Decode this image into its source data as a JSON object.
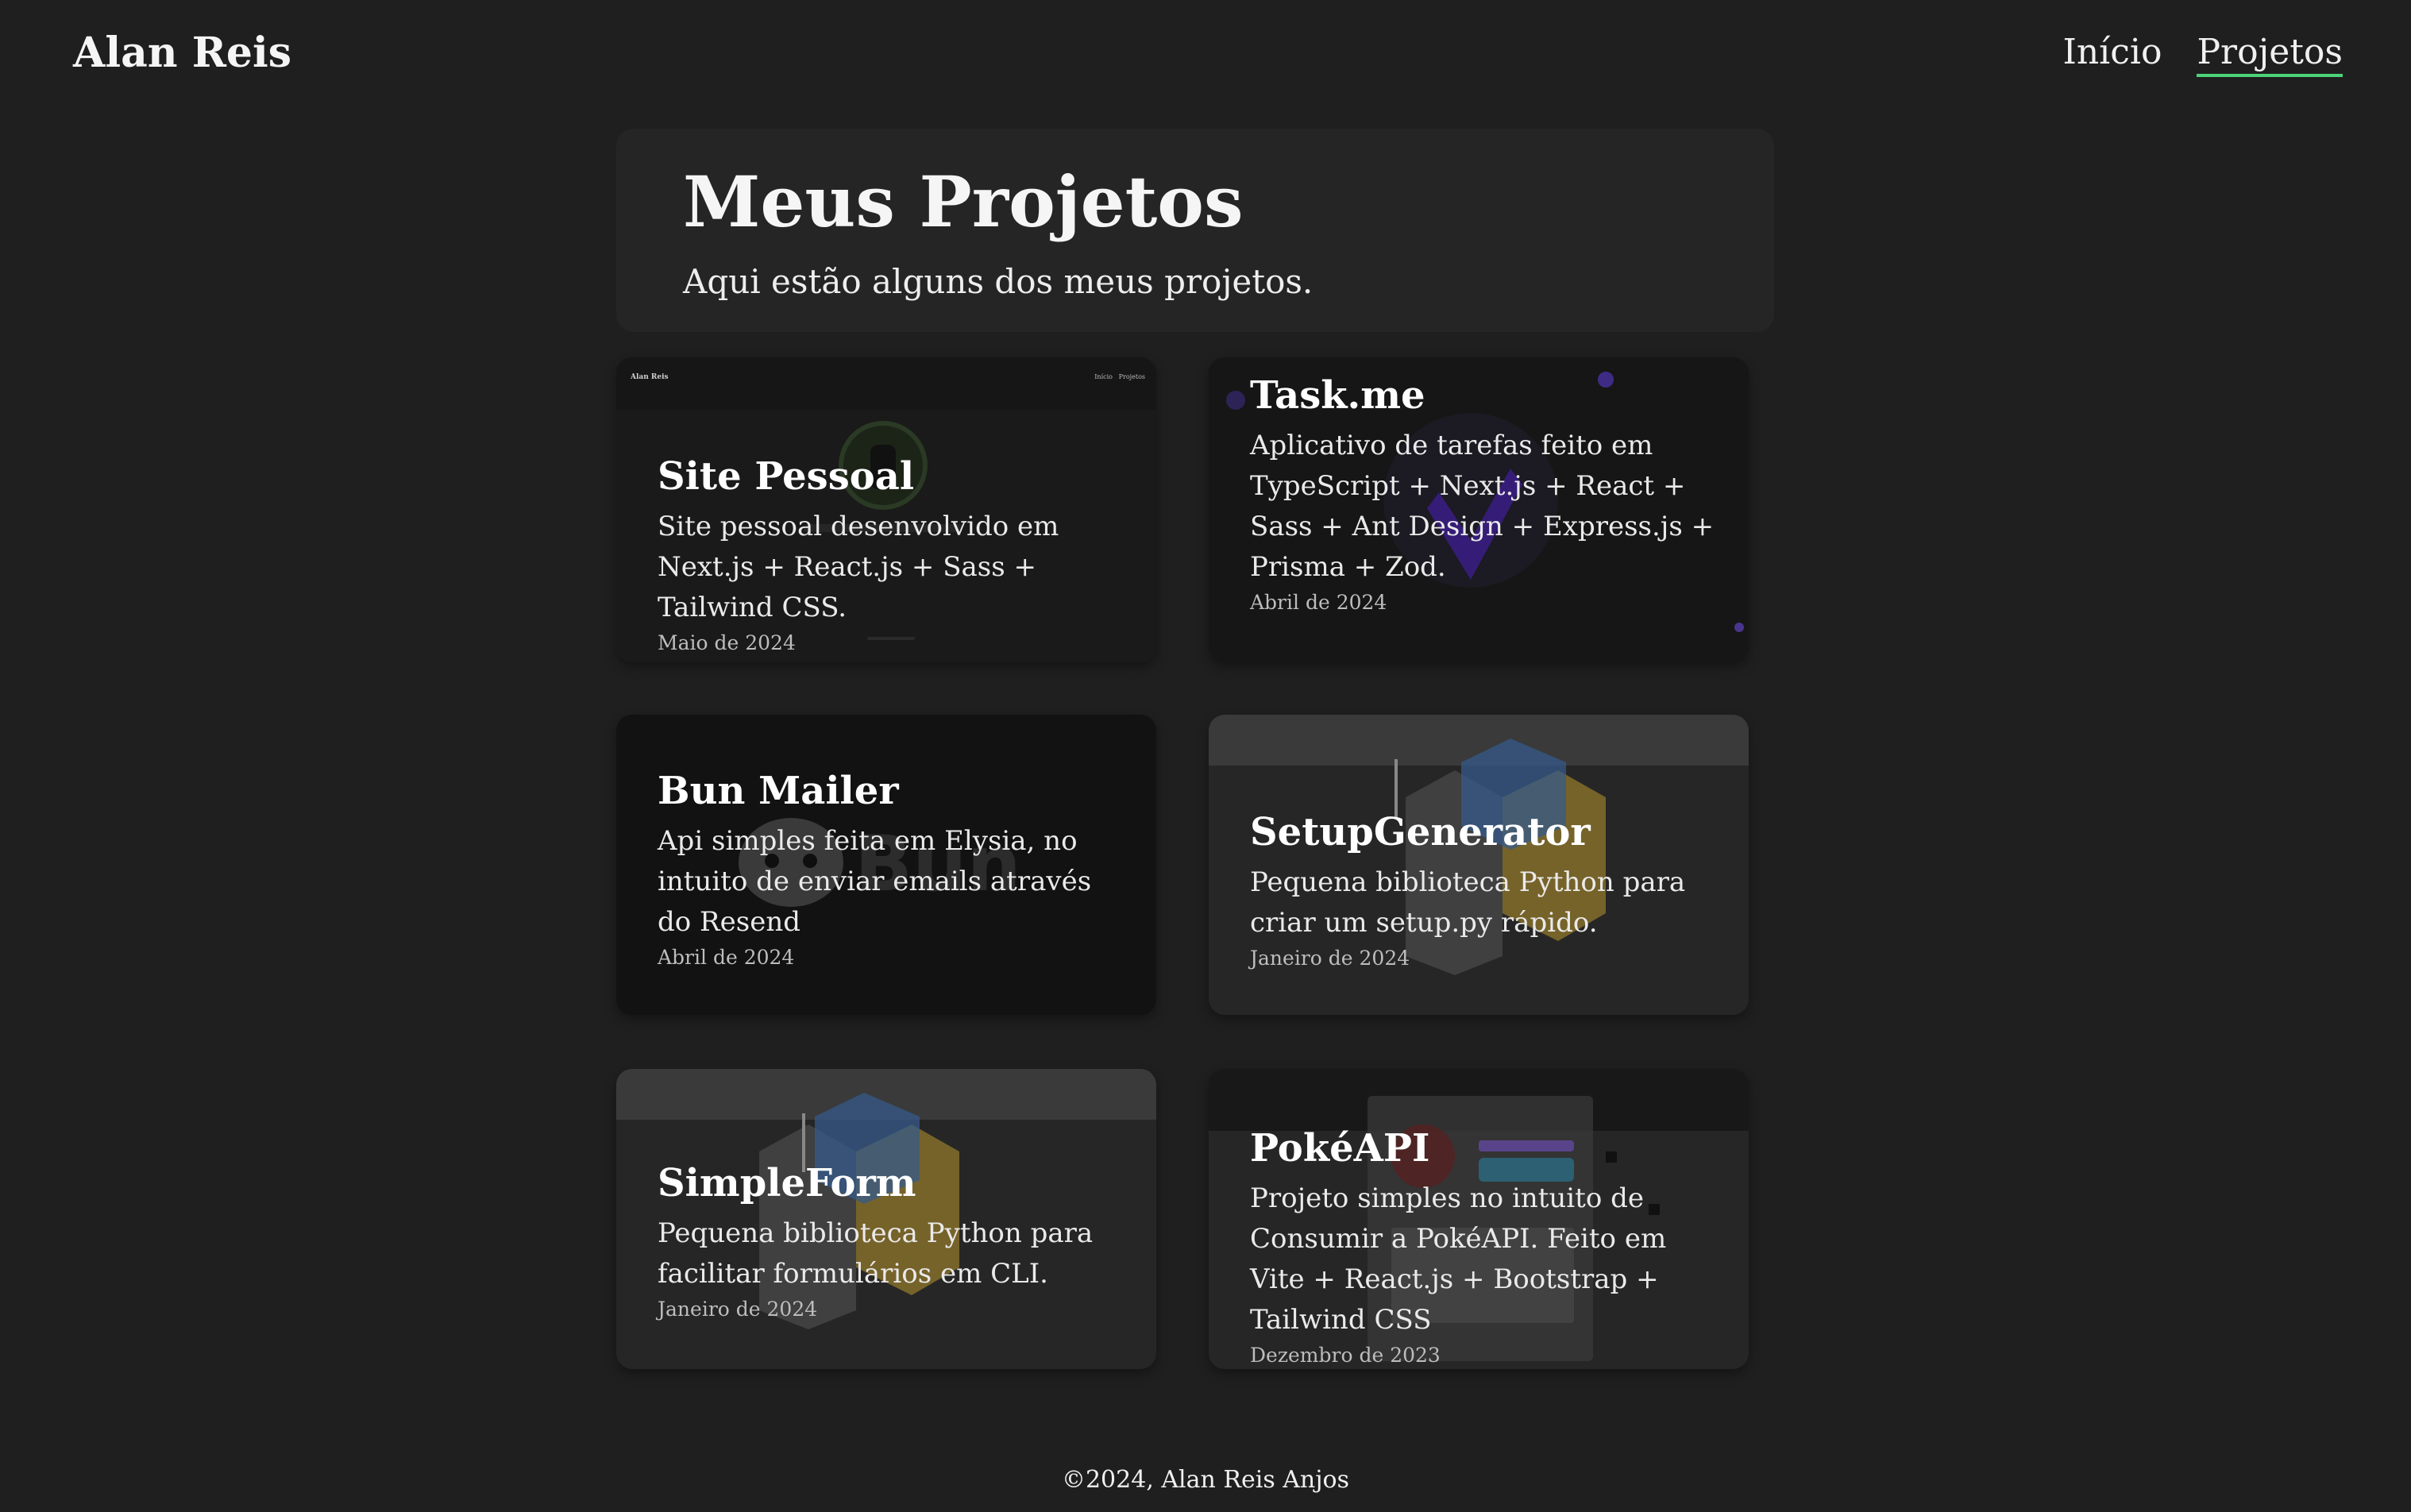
{
  "header": {
    "brand": "Alan Reis",
    "nav": [
      {
        "label": "Início"
      },
      {
        "label": "Projetos"
      }
    ]
  },
  "hero": {
    "title": "Meus Projetos",
    "subtitle": "Aqui estão alguns dos meus projetos."
  },
  "projects": [
    {
      "title": "Site Pessoal",
      "description": "Site pessoal desenvolvido em Next.js + React.js + Sass + Tailwind CSS.",
      "date": "Maio de 2024",
      "thumb_brand": "Alan Reis",
      "thumb_nav": "Início   Projetos"
    },
    {
      "title": "Task.me",
      "description": "Aplicativo de tarefas feito em TypeScript + Next.js + React + Sass + Ant Design + Express.js + Prisma + Zod.",
      "date": "Abril de 2024"
    },
    {
      "title": "Bun Mailer",
      "description": "Api simples feita em Elysia, no intuito de enviar emails através do Resend",
      "date": "Abril de 2024",
      "thumb_logo": "Bun"
    },
    {
      "title": "SetupGenerator",
      "description": "Pequena biblioteca Python para criar um setup.py rápido.",
      "date": "Janeiro de 2024"
    },
    {
      "title": "SimpleForm",
      "description": "Pequena biblioteca Python para facilitar formulários em CLI.",
      "date": "Janeiro de 2024"
    },
    {
      "title": "PokéAPI",
      "description": "Projeto simples no intuito de Consumir a PokéAPI. Feito em Vite + React.js + Bootstrap + Tailwind CSS",
      "date": "Dezembro de 2023"
    }
  ],
  "footer": {
    "text": "©2024, Alan Reis Anjos"
  },
  "colors": {
    "background": "#1f1f1f",
    "hero_bg": "#252525",
    "nav_underline": "#4cd47a"
  }
}
